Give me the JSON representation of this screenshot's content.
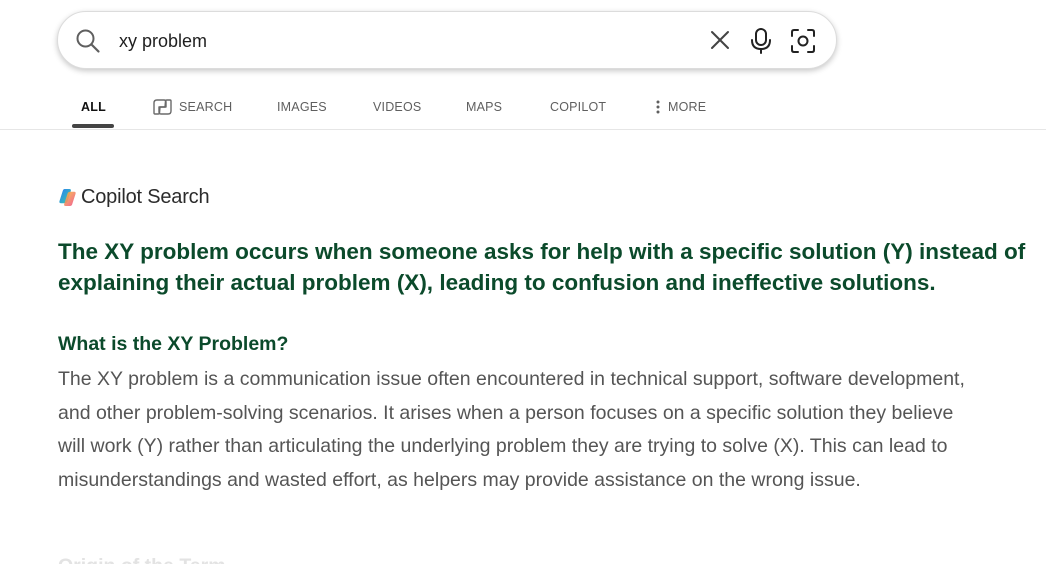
{
  "search": {
    "query": "xy problem"
  },
  "icons": {
    "search": "search-icon",
    "clear": "close-icon",
    "mic": "microphone-icon",
    "visual_search": "camera-lens-icon",
    "copilot_search_tab": "copilot-search-icon",
    "more": "more-vertical-icon",
    "copilot_logo": "copilot-logo"
  },
  "tabs": [
    {
      "label": "ALL",
      "active": true
    },
    {
      "label": "SEARCH"
    },
    {
      "label": "IMAGES"
    },
    {
      "label": "VIDEOS"
    },
    {
      "label": "MAPS"
    },
    {
      "label": "COPILOT"
    },
    {
      "label": "MORE"
    }
  ],
  "copilot": {
    "title": "Copilot Search",
    "answer_heading": "The XY problem occurs when someone asks for help with a specific solution (Y) instead of explaining their actual problem (X), leading to confusion and ineffective solutions.",
    "section_title": "What is the XY Problem?",
    "section_body": "The XY problem is a communication issue often encountered in technical support, software development, and other problem-solving scenarios. It arises when a person focuses on a specific solution they believe will work (Y) rather than articulating the underlying problem they are trying to solve (X). This can lead to misunderstandings and wasted effort, as helpers may provide assistance on the wrong issue.",
    "next_section_title": "Origin of the Term"
  },
  "colors": {
    "heading_green": "#0b4a2b",
    "body_gray": "#555555",
    "tab_active": "#111111",
    "tab_inactive": "#5f5f5f"
  }
}
